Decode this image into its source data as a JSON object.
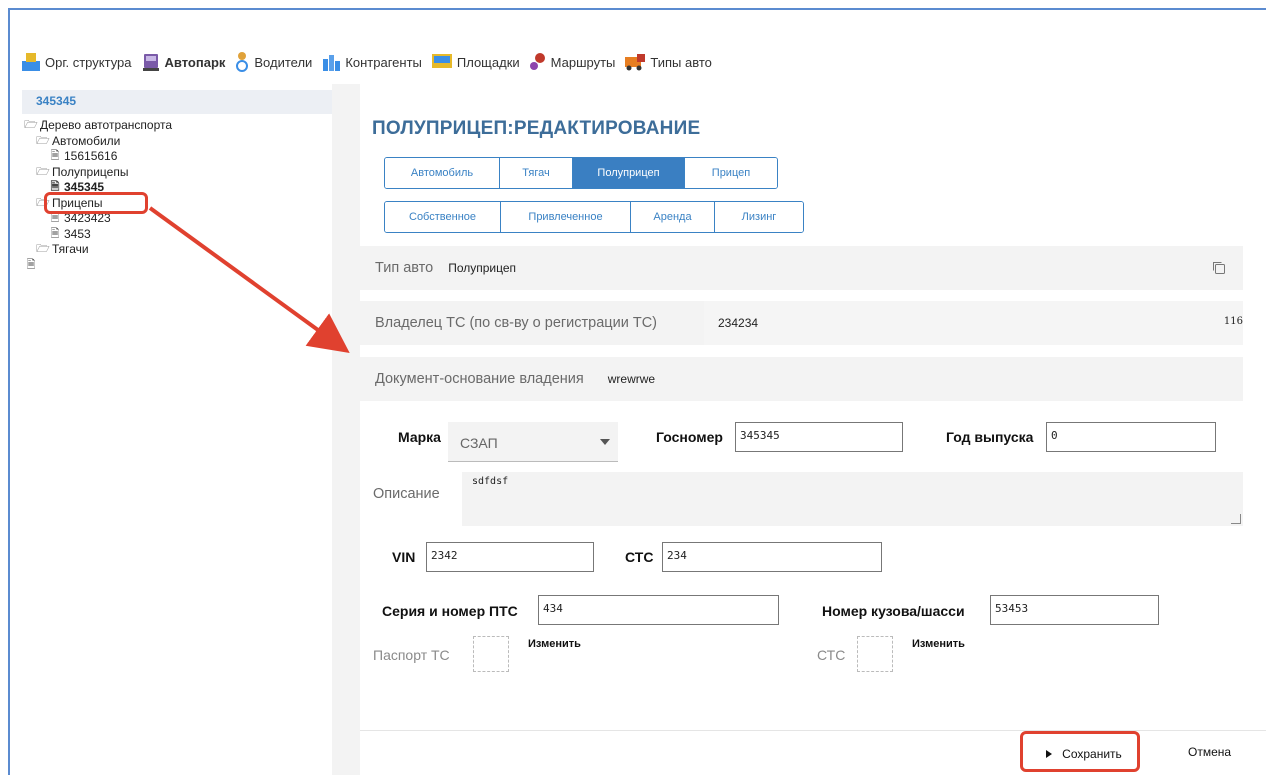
{
  "nav": {
    "items": [
      {
        "label": "Орг. структура",
        "icon": "org-structure-icon",
        "color": "#3a8ee6"
      },
      {
        "label": "Автопарк",
        "icon": "truck-icon",
        "color": "#7a5aa8"
      },
      {
        "label": "Водители",
        "icon": "driver-icon",
        "color": "#e0a23a"
      },
      {
        "label": "Контрагенты",
        "icon": "contractors-icon",
        "color": "#3a8ee6"
      },
      {
        "label": "Площадки",
        "icon": "sites-icon",
        "color": "#e6b92a"
      },
      {
        "label": "Маршруты",
        "icon": "routes-icon",
        "color": "#c0392b"
      },
      {
        "label": "Типы авто",
        "icon": "vehicle-types-icon",
        "color": "#e67e22"
      }
    ]
  },
  "sidebar": {
    "header": "345345",
    "tree": [
      {
        "label": "Дерево автотранспорта",
        "type": "folder",
        "level": 0
      },
      {
        "label": "Автомобили",
        "type": "folder",
        "level": 1
      },
      {
        "label": "15615616",
        "type": "doc",
        "level": 1
      },
      {
        "label": "Полуприцепы",
        "type": "folder",
        "level": 1
      },
      {
        "label": "345345",
        "type": "doc",
        "level": 1,
        "selected": true
      },
      {
        "label": "Прицепы",
        "type": "folder",
        "level": 1
      },
      {
        "label": "3423423",
        "type": "doc",
        "level": 1
      },
      {
        "label": "3453",
        "type": "doc",
        "level": 1
      },
      {
        "label": "Тягачи",
        "type": "folder",
        "level": 1
      },
      {
        "label": "",
        "type": "doc",
        "level": 0
      }
    ]
  },
  "main": {
    "title": "ПОЛУПРИЦЕП:РЕДАКТИРОВАНИЕ",
    "type_tabs": [
      "Автомобиль",
      "Тягач",
      "Полуприцеп",
      "Прицеп"
    ],
    "type_active": "Полуприцеп",
    "ownership_tabs": [
      "Собственное",
      "Привлеченное",
      "Аренда",
      "Лизинг"
    ],
    "type_auto": {
      "label": "Тип авто",
      "value": "Полуприцеп"
    },
    "owner": {
      "label": "Владелец ТС (по св-ву о регистрации ТС)",
      "value": "234234",
      "suffix": "116"
    },
    "basis_doc": {
      "label": "Документ-основание владения",
      "value": "wrewrwe"
    },
    "brand": {
      "label": "Марка",
      "value": "СЗАП"
    },
    "plate": {
      "label": "Госномер",
      "value": "345345"
    },
    "year": {
      "label": "Год выпуска",
      "value": "0"
    },
    "description": {
      "label": "Описание",
      "value": "sdfdsf"
    },
    "vin": {
      "label": "VIN",
      "value": "2342"
    },
    "stc": {
      "label": "СТС",
      "value": "234"
    },
    "pts": {
      "label": "Серия и номер ПТС",
      "value": "434"
    },
    "body": {
      "label": "Номер кузова/шасси",
      "value": "53453"
    },
    "passport": {
      "label": "Паспорт ТС",
      "change": "Изменить"
    },
    "stc_doc": {
      "label": "СТС",
      "change": "Изменить"
    }
  },
  "footer": {
    "save": "Сохранить",
    "cancel": "Отмена"
  },
  "colors": {
    "accent": "#3a82c4",
    "annotation": "#e0412f",
    "title": "#3d6d99"
  }
}
